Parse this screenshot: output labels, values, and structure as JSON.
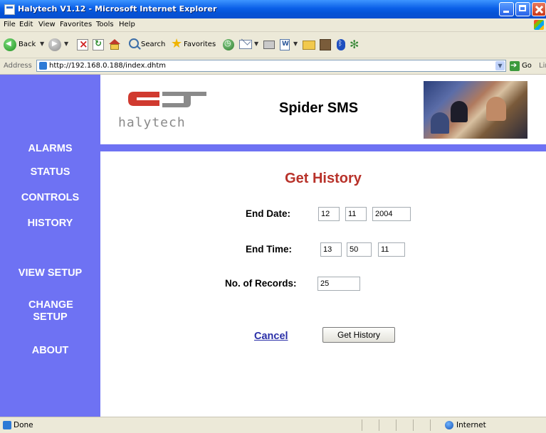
{
  "window": {
    "title": "Halytech V1.12 - Microsoft Internet Explorer"
  },
  "menu": {
    "items": [
      "File",
      "Edit",
      "View",
      "Favorites",
      "Tools",
      "Help"
    ]
  },
  "toolbar": {
    "back_label": "Back",
    "search_label": "Search",
    "favorites_label": "Favorites"
  },
  "address": {
    "label": "Address",
    "url": "http://192.168.0.188/index.dhtm",
    "go_label": "Go",
    "links_label": "Links"
  },
  "header": {
    "logo_text": "halytech",
    "site_title": "Spider SMS",
    "colors": {
      "logo_red": "#d03a2f",
      "logo_grey": "#8a8a8a"
    }
  },
  "sidebar": {
    "color": "#6e72f3",
    "items": [
      {
        "label": "ALARMS"
      },
      {
        "label": "STATUS"
      },
      {
        "label": "CONTROLS"
      },
      {
        "label": "HISTORY"
      },
      {
        "label": "VIEW SETUP"
      },
      {
        "label": "CHANGE SETUP"
      },
      {
        "label": "ABOUT"
      }
    ]
  },
  "form": {
    "heading": "Get History",
    "heading_color": "#b8322a",
    "end_date_label": "End Date:",
    "end_date": {
      "day": "12",
      "month": "11",
      "year": "2004"
    },
    "end_time_label": "End Time:",
    "end_time": {
      "hour": "13",
      "minute": "50",
      "second": "11"
    },
    "records_label": "No. of Records:",
    "records": "25",
    "cancel_label": "Cancel",
    "submit_label": "Get History"
  },
  "status": {
    "text": "Done",
    "zone": "Internet"
  }
}
